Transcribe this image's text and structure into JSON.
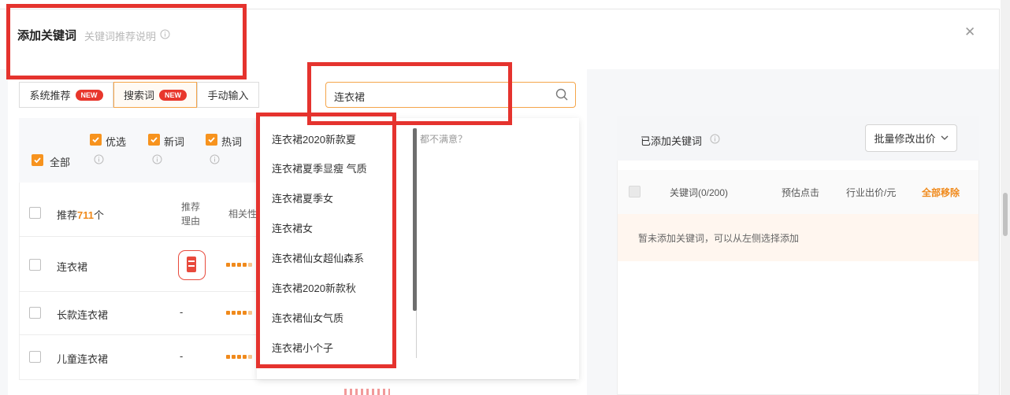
{
  "dialog": {
    "title": "添加关键词",
    "subtitle": "关键词推荐说明",
    "info_icon": "info-icon",
    "close_icon": "close-icon",
    "close_glyph": "✕"
  },
  "tabs": [
    {
      "label": "系统推荐",
      "badge": "NEW",
      "active": false
    },
    {
      "label": "搜索词",
      "badge": "NEW",
      "active": true
    },
    {
      "label": "手动输入",
      "active": false
    }
  ],
  "search": {
    "value": "连衣裙",
    "icon": "search-icon"
  },
  "filters": {
    "all_label": "全部",
    "options": [
      "优选",
      "新词",
      "热词"
    ],
    "all_checked": true
  },
  "table": {
    "count_prefix": "推荐",
    "count": "711",
    "count_suffix": "个",
    "col_reason": "推荐理由",
    "col_relevance": "相关性",
    "relevance_max": 5,
    "rows": [
      {
        "keyword": "连衣裙",
        "reason_icon": "hot-word-icon",
        "relevance": 4
      },
      {
        "keyword": "长款连衣裙",
        "reason": "-",
        "relevance": 4
      },
      {
        "keyword": "儿童连衣裙",
        "reason": "-",
        "relevance": 4
      }
    ]
  },
  "suggestions": {
    "items": [
      "连衣裙2020新款夏",
      "连衣裙夏季显瘦 气质",
      "连衣裙夏季女",
      "连衣裙女",
      "连衣裙仙女超仙森系",
      "连衣裙2020新款秋",
      "连衣裙仙女气质",
      "连衣裙小个子"
    ],
    "hint": "都不满意？"
  },
  "selected": {
    "title": "已添加关键词",
    "batch_button": "批量修改出价",
    "col_keyword": "关键词(0/200)",
    "col_clicks": "预估点击",
    "col_bid": "行业出价/元",
    "remove_all": "全部移除",
    "empty_text": "暂未添加关键词，可以从左侧选择添加"
  },
  "colors": {
    "accent": "#f7931e",
    "badge": "#e8372c",
    "annotation": "#e5332e"
  }
}
